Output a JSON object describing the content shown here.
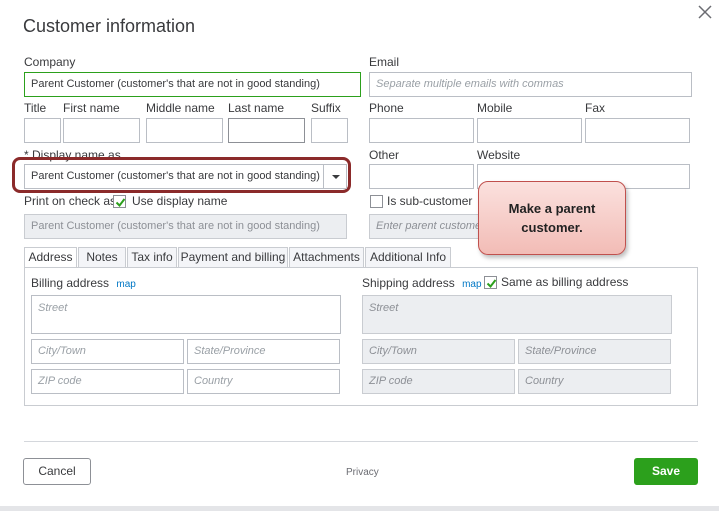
{
  "dialog": {
    "title": "Customer information",
    "close_icon": "close-icon"
  },
  "fields": {
    "company": {
      "label": "Company",
      "value": "Parent Customer (customer's that are not in good standing)"
    },
    "email": {
      "label": "Email",
      "placeholder": "Separate multiple emails with commas"
    },
    "title": {
      "label": "Title",
      "value": ""
    },
    "first_name": {
      "label": "First name",
      "value": ""
    },
    "middle_name": {
      "label": "Middle name",
      "value": ""
    },
    "last_name": {
      "label": "Last name",
      "value": ""
    },
    "suffix": {
      "label": "Suffix",
      "value": ""
    },
    "phone": {
      "label": "Phone",
      "value": ""
    },
    "mobile": {
      "label": "Mobile",
      "value": ""
    },
    "fax": {
      "label": "Fax",
      "value": ""
    },
    "display_name": {
      "label": "* Display name as",
      "value": "Parent Customer (customer's that are not in good standing)"
    },
    "other": {
      "label": "Other",
      "value": ""
    },
    "website": {
      "label": "Website",
      "value": ""
    },
    "print_on_check": {
      "label": "Print on check as",
      "checkbox_label": "Use display name",
      "checked": true,
      "value": "Parent Customer (customer's that are not in good standing)"
    },
    "sub_customer": {
      "checkbox_label": "Is sub-customer",
      "checked": false,
      "placeholder": "Enter parent customer"
    }
  },
  "callout": {
    "text": "Make a parent customer.",
    "color": "#f4c7c3"
  },
  "tabs": [
    {
      "label": "Address",
      "active": true
    },
    {
      "label": "Notes"
    },
    {
      "label": "Tax info"
    },
    {
      "label": "Payment and billing"
    },
    {
      "label": "Attachments"
    },
    {
      "label": "Additional Info"
    }
  ],
  "billing": {
    "label": "Billing address",
    "map": "map",
    "street": "Street",
    "city": "City/Town",
    "state": "State/Province",
    "zip": "ZIP code",
    "country": "Country"
  },
  "shipping": {
    "label": "Shipping address",
    "map": "map",
    "same_label": "Same as billing address",
    "same_checked": true,
    "street": "Street",
    "city": "City/Town",
    "state": "State/Province",
    "zip": "ZIP code",
    "country": "Country"
  },
  "footer": {
    "cancel": "Cancel",
    "privacy": "Privacy",
    "save": "Save"
  },
  "colors": {
    "accent_green": "#2ca01c",
    "highlight_box": "#8b2a2a",
    "link_blue": "#0077c5"
  }
}
